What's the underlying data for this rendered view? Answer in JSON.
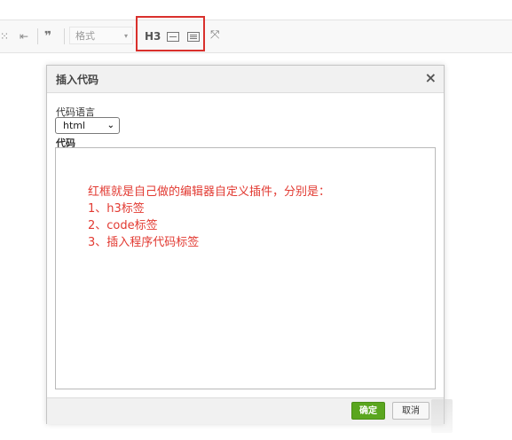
{
  "toolbar": {
    "left_glyphs": [
      "⁙",
      "⇤",
      "❞"
    ],
    "format_label": "格式",
    "format_caret": "▾",
    "h3_label": "H3",
    "fullscreen_glyph": "⤧",
    "highlight_color": "#d9302c"
  },
  "dialog": {
    "title": "插入代码",
    "close_glyph": "×",
    "language_label": "代码语言",
    "language_value": "html",
    "language_caret": "⌄",
    "code_label": "代码",
    "note_color": "#e23a32",
    "note_lines": [
      "红框就是自己做的编辑器自定义插件，分别是：",
      "1、h3标签",
      "2、code标签",
      "3、插入程序代码标签"
    ],
    "ok_label": "确定",
    "cancel_label": "取消",
    "ok_color": "#5aa61f"
  }
}
